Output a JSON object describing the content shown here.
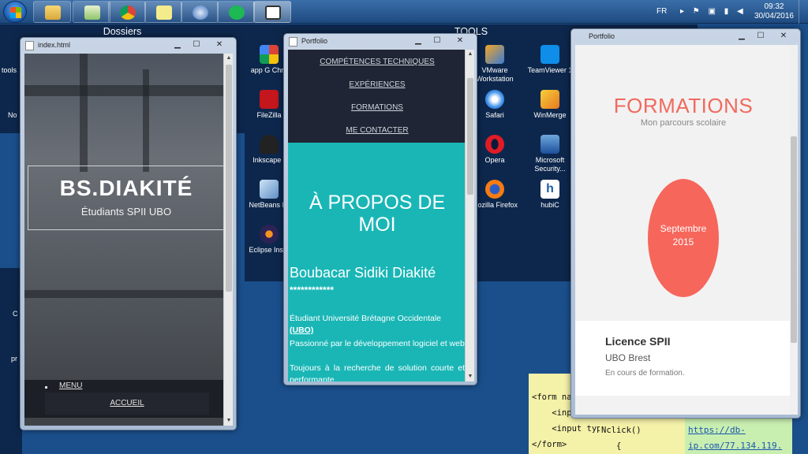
{
  "taskbar": {
    "language": "FR",
    "clock_time": "09:32",
    "clock_date": "30/04/2016",
    "apps": [
      "explorer",
      "notes",
      "chrome",
      "sticky-notes",
      "thunderbird",
      "spotify",
      "desktop"
    ]
  },
  "fences": {
    "dossiers_title": "Dossiers",
    "tools_title": "TOOLS",
    "left_labels": [
      "tools",
      "No",
      "C",
      "pr"
    ],
    "tools_items": [
      {
        "label": "app G Chro",
        "icon": "apps-icon"
      },
      {
        "label": "FileZilla",
        "icon": "filezilla-icon"
      },
      {
        "label": "Inkscape (",
        "icon": "inkscape-icon"
      },
      {
        "label": "NetBeans ID",
        "icon": "netbeans-icon"
      },
      {
        "label": "Eclipse Insta",
        "icon": "eclipse-icon"
      },
      {
        "label": "VMware Workstation",
        "icon": "vmware-icon"
      },
      {
        "label": "Safari",
        "icon": "safari-icon"
      },
      {
        "label": "Opera",
        "icon": "opera-icon"
      },
      {
        "label": "Mozilla Firefox",
        "icon": "firefox-icon"
      },
      {
        "label": "TeamViewer 1",
        "icon": "teamviewer-icon"
      },
      {
        "label": "WinMerge",
        "icon": "winmerge-icon"
      },
      {
        "label": "Microsoft Security...",
        "icon": "security-icon"
      },
      {
        "label": "hubiC",
        "icon": "hubic-icon"
      }
    ]
  },
  "stickies": {
    "code_lines": [
      "<form na",
      "    <inpu",
      "    <input type",
      "</form>"
    ],
    "code_right": [
      "Nclick()",
      "   {"
    ],
    "link_lines": [
      "https://db-",
      "ip.com/77.134.119."
    ]
  },
  "win1": {
    "title": "index.html",
    "hero_name": "BS.DIAKITÉ",
    "hero_sub": "Étudiants SPII UBO",
    "menu": "MENU",
    "accueil": "ACCUEIL"
  },
  "win2": {
    "title": "Portfolio",
    "nav": [
      "COMPÉTENCES TECHNIQUES",
      "EXPÉRIENCES",
      "FORMATIONS",
      "ME CONTACTER"
    ],
    "about_title_1": "À PROPOS DE",
    "about_title_2": "MOI",
    "name": "Boubacar Sidiki Diakité",
    "stars": "************",
    "p1": "Étudiant Université Brétagne Occidentale",
    "p1_ubo": "(UBO)",
    "p2": "Passionné par le développement logiciel et web",
    "p3": "Toujours à la recherche de solution courte et performante"
  },
  "win3": {
    "title": "Portfolio",
    "heading": "FORMATIONS",
    "sub": "Mon parcours scolaire",
    "date_1": "Septembre",
    "date_2": "2015",
    "card_title": "Licence SPII",
    "card_school": "UBO Brest",
    "card_status": "En cours de formation."
  },
  "colors": {
    "desktop": "#1b4f8c",
    "teal": "#1ab6b6",
    "coral": "#f6665b",
    "nav_dark": "#1f2534"
  }
}
